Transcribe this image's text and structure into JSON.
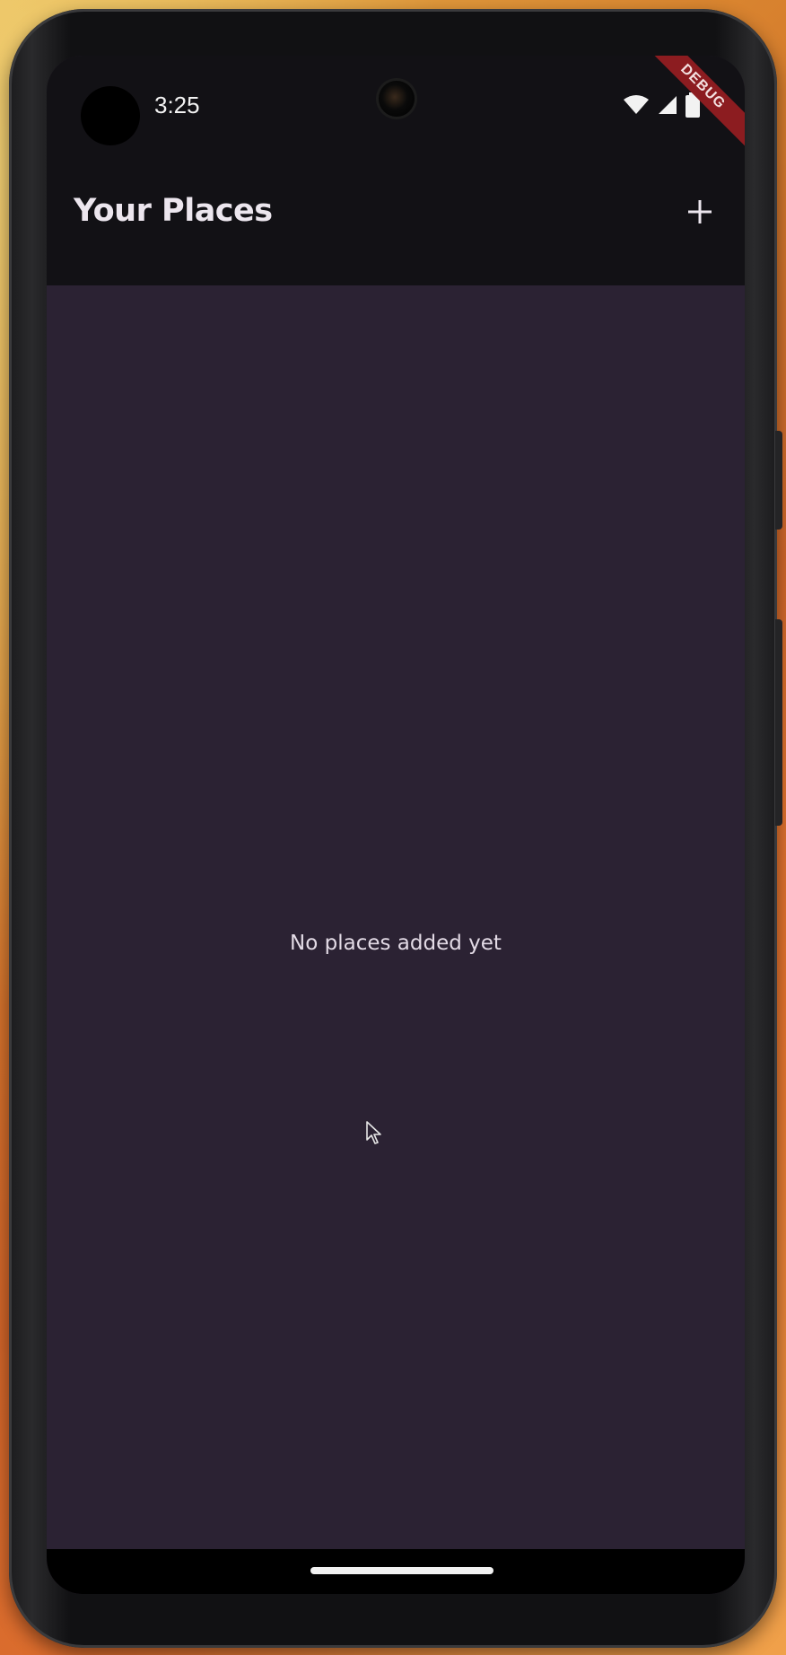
{
  "status_bar": {
    "time": "3:25"
  },
  "debug_banner": {
    "label": "DEBUG"
  },
  "app_bar": {
    "title": "Your Places",
    "add_icon": "plus-icon"
  },
  "body": {
    "empty_message": "No places added yet"
  },
  "colors": {
    "app_bar_bg": "#121115",
    "body_bg": "#2b2233",
    "text": "#ece6ee",
    "debug_ribbon": "#8c1c20"
  }
}
